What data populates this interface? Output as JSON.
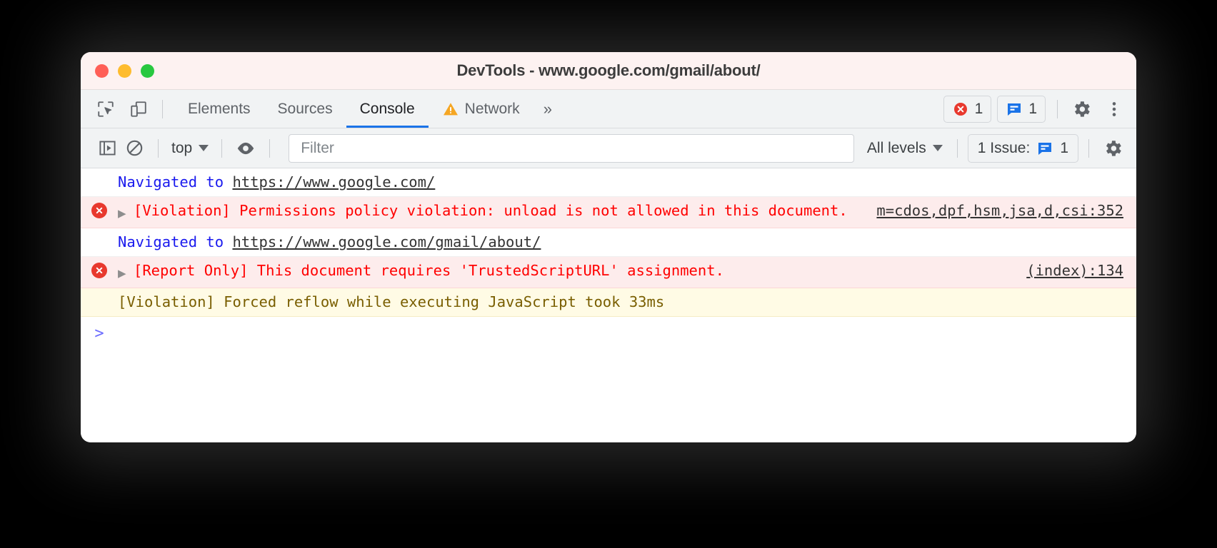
{
  "window": {
    "title": "DevTools - www.google.com/gmail/about/",
    "traffic_lights": [
      "close",
      "minimize",
      "maximize"
    ]
  },
  "tabbar": {
    "left_icons": [
      {
        "name": "inspect-element-icon",
        "label": "Inspect element"
      },
      {
        "name": "device-toolbar-icon",
        "label": "Toggle device toolbar"
      }
    ],
    "tabs": [
      {
        "label": "Elements",
        "active": false,
        "warning": false
      },
      {
        "label": "Sources",
        "active": false,
        "warning": false
      },
      {
        "label": "Console",
        "active": true,
        "warning": false
      },
      {
        "label": "Network",
        "active": false,
        "warning": true
      }
    ],
    "more_tabs_label": "»",
    "error_count": "1",
    "issues_count": "1",
    "settings_label": "Settings",
    "more_options_label": "Customize and control DevTools"
  },
  "console_toolbar": {
    "sidebar_toggle_label": "Show console sidebar",
    "clear_console_label": "Clear console",
    "context_value": "top",
    "live_expression_label": "Create live expression",
    "filter": {
      "value": "",
      "placeholder": "Filter"
    },
    "levels_value": "All levels",
    "issues_button": {
      "text": "1 Issue:",
      "count": "1"
    },
    "settings_label": "Console settings"
  },
  "console_messages": [
    {
      "type": "info",
      "icon": null,
      "expandable": false,
      "text_prefix": "Navigated to ",
      "link": "https://www.google.com/",
      "source": null
    },
    {
      "type": "error",
      "icon": "error-icon",
      "expandable": true,
      "text_prefix": "[Violation] Permissions policy violation: unload is not allowed in this document.",
      "link": null,
      "source": "m=cdos,dpf,hsm,jsa,d,csi:352"
    },
    {
      "type": "info",
      "icon": null,
      "expandable": false,
      "text_prefix": "Navigated to ",
      "link": "https://www.google.com/gmail/about/",
      "source": null
    },
    {
      "type": "error",
      "icon": "error-icon",
      "expandable": true,
      "text_prefix": "[Report Only] This document requires 'TrustedScriptURL' assignment.",
      "link": null,
      "source": "(index):134"
    },
    {
      "type": "warn",
      "icon": null,
      "expandable": false,
      "text_prefix": "[Violation] Forced reflow while executing JavaScript took 33ms",
      "link": null,
      "source": null
    }
  ],
  "prompt": {
    "caret": ">",
    "value": ""
  },
  "colors": {
    "accent_blue": "#1a73e8",
    "error_red": "#e8392e",
    "error_bg": "#fdecec",
    "warn_bg": "#fffbe5",
    "warn_text": "#795e00",
    "issue_blue": "#1a73e8",
    "warning_orange": "#f5a623",
    "titlebar_bg": "#fdf2f1",
    "toolbar_bg": "#f1f3f4"
  }
}
